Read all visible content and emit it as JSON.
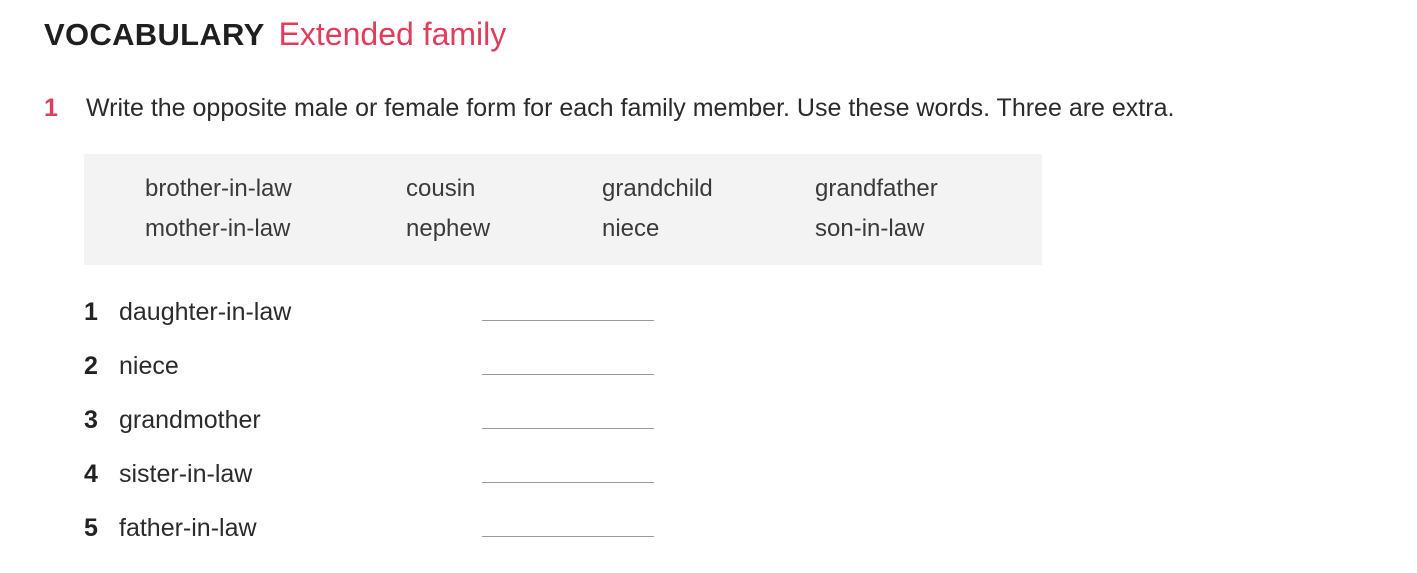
{
  "heading": {
    "title": "VOCABULARY",
    "subtitle": "Extended family"
  },
  "exercise": {
    "number": "1",
    "instruction": "Write the opposite male or female form for each family member. Use these words. Three are extra."
  },
  "word_box": {
    "rows": [
      [
        "brother-in-law",
        "cousin",
        "grandchild",
        "grandfather"
      ],
      [
        "mother-in-law",
        "nephew",
        "niece",
        "son-in-law"
      ]
    ]
  },
  "items": [
    {
      "number": "1",
      "word": "daughter-in-law",
      "answer": ""
    },
    {
      "number": "2",
      "word": "niece",
      "answer": ""
    },
    {
      "number": "3",
      "word": "grandmother",
      "answer": ""
    },
    {
      "number": "4",
      "word": "sister-in-law",
      "answer": ""
    },
    {
      "number": "5",
      "word": "father-in-law",
      "answer": ""
    }
  ],
  "colors": {
    "accent": "#e23c5c",
    "box_background": "#f3f3f3",
    "text": "#2b2b2b"
  }
}
